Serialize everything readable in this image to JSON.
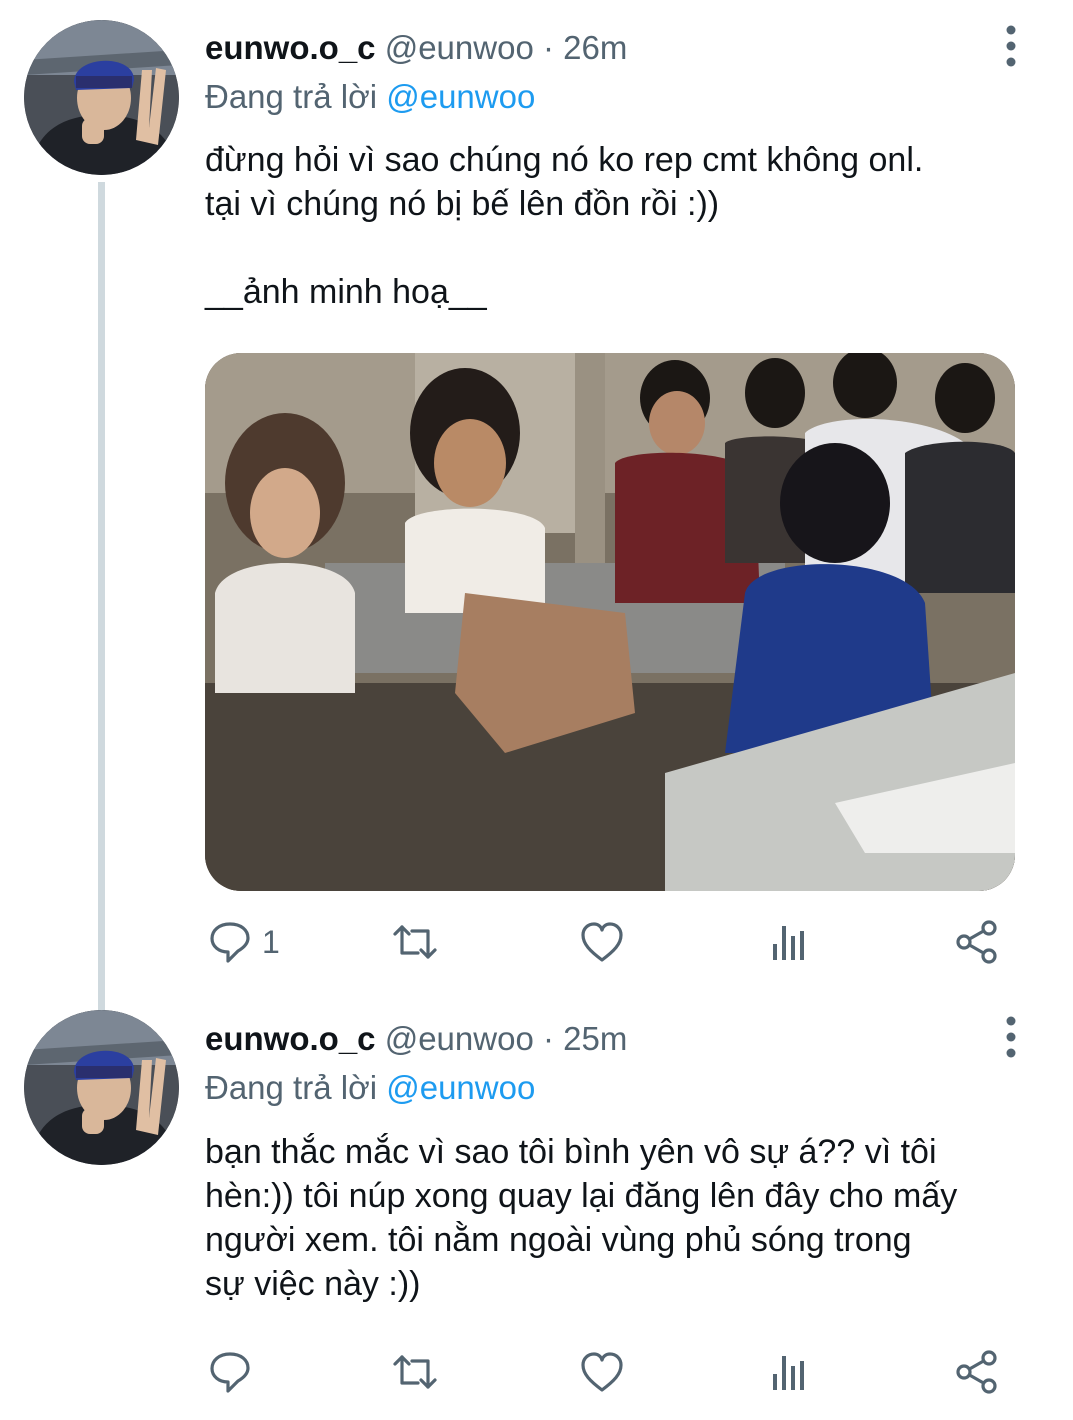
{
  "tweets": [
    {
      "display_name": "eunwo.o_c",
      "handle": "@eunwoo",
      "separator": "·",
      "time": "26m",
      "reply_prefix": "Đang trả lời",
      "reply_to": "@eunwoo",
      "text": "đừng hỏi vì sao chúng nó ko rep cmt không onl.\ntại vì chúng nó bị bế lên đồn rồi :))\n\n__ảnh minh hoạ__",
      "reply_count": "1"
    },
    {
      "display_name": "eunwo.o_c",
      "handle": "@eunwoo",
      "separator": "·",
      "time": "25m",
      "reply_prefix": "Đang trả lời",
      "reply_to": "@eunwoo",
      "text": "bạn thắc mắc vì sao tôi bình yên vô sự á?? vì tôi\nhèn:)) tôi núp xong quay lại đăng lên đây cho mấy\nngười xem. tôi nằm ngoài vùng phủ sóng trong\nsự việc này :))",
      "reply_count": ""
    }
  ],
  "icons": {
    "more": "more-vertical-icon",
    "reply": "reply-icon",
    "retweet": "retweet-icon",
    "like": "heart-icon",
    "analytics": "analytics-icon",
    "share": "share-icon"
  },
  "colors": {
    "text": "#0f1419",
    "secondary": "#536471",
    "accent": "#1d9bf0",
    "thread_line": "#cfd9de"
  }
}
